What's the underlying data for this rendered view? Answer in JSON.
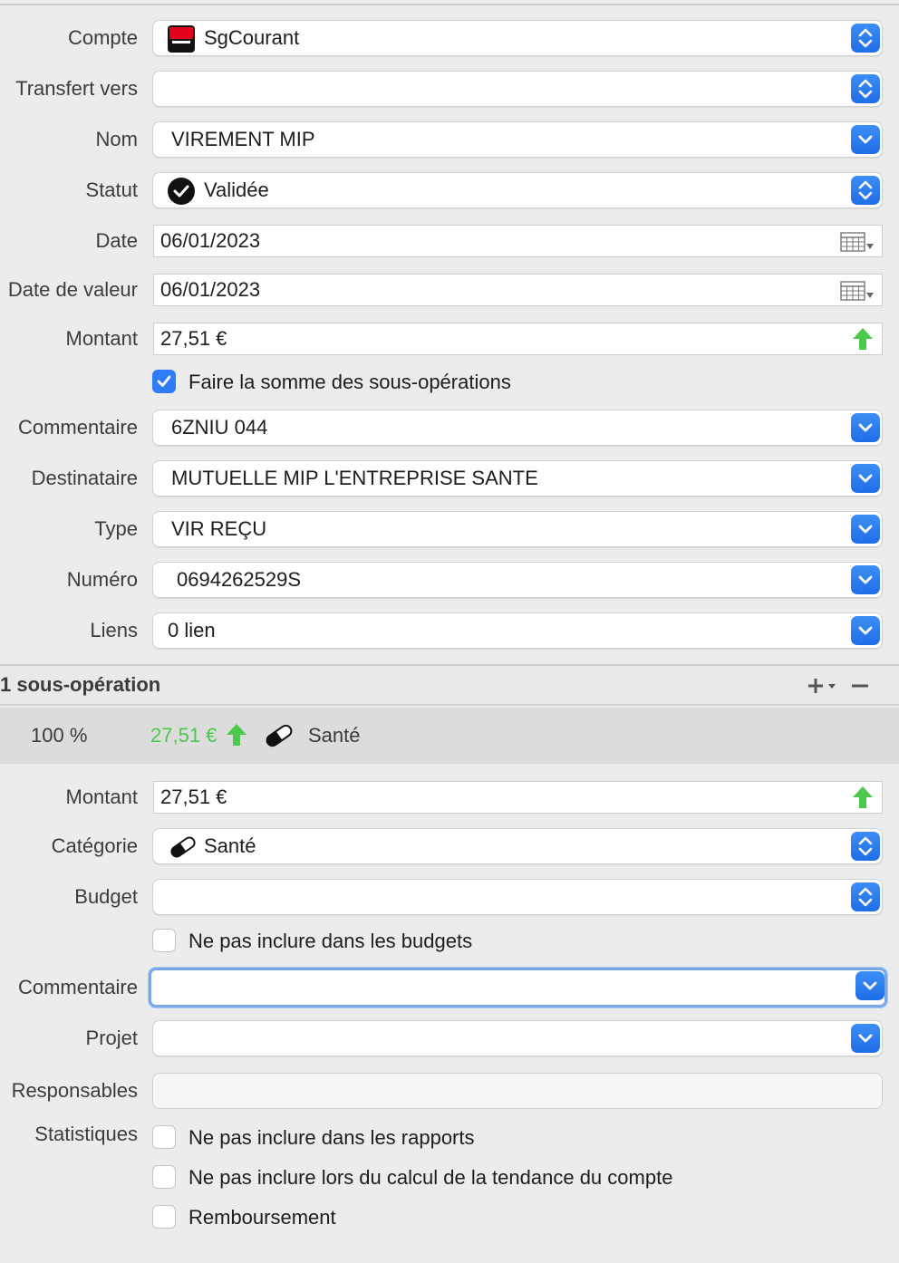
{
  "form": {
    "compte": {
      "label": "Compte",
      "value": "SgCourant",
      "icon": "bank-logo-icon"
    },
    "transfert": {
      "label": "Transfert vers",
      "value": ""
    },
    "nom": {
      "label": "Nom",
      "value": "VIREMENT MIP"
    },
    "statut": {
      "label": "Statut",
      "value": "Validée",
      "icon": "checkmark-circle-icon"
    },
    "date": {
      "label": "Date",
      "value": "06/01/2023"
    },
    "date_valeur": {
      "label": "Date de valeur",
      "value": "06/01/2023"
    },
    "montant": {
      "label": "Montant",
      "value": "27,51 €"
    },
    "somme_sous_ops": {
      "label": "Faire la somme des sous-opérations",
      "checked": true
    },
    "commentaire": {
      "label": "Commentaire",
      "value": "6ZNIU 044"
    },
    "destinataire": {
      "label": "Destinataire",
      "value": "MUTUELLE MIP L'ENTREPRISE SANTE"
    },
    "type": {
      "label": "Type",
      "value": "VIR REÇU"
    },
    "numero": {
      "label": "Numéro",
      "value": "0694262529S"
    },
    "liens": {
      "label": "Liens",
      "value": "0 lien"
    }
  },
  "suboperations": {
    "title": "1 sous-opération",
    "add_label": "+",
    "remove_label": "−",
    "items": [
      {
        "percent": "100 %",
        "amount": "27,51 €",
        "category": "Santé",
        "icon": "pill-icon"
      }
    ]
  },
  "subform": {
    "montant": {
      "label": "Montant",
      "value": "27,51 €"
    },
    "categorie": {
      "label": "Catégorie",
      "value": "Santé",
      "icon": "pill-icon"
    },
    "budget": {
      "label": "Budget",
      "value": ""
    },
    "exclude_budgets": {
      "label": "Ne pas inclure dans les budgets",
      "checked": false
    },
    "commentaire": {
      "label": "Commentaire",
      "value": ""
    },
    "projet": {
      "label": "Projet",
      "value": ""
    },
    "responsables": {
      "label": "Responsables",
      "value": ""
    },
    "statistiques": {
      "label": "Statistiques"
    },
    "exclude_reports": {
      "label": "Ne pas inclure dans les rapports",
      "checked": false
    },
    "exclude_trend": {
      "label": "Ne pas inclure lors du calcul de la tendance du compte",
      "checked": false
    },
    "remboursement": {
      "label": "Remboursement",
      "checked": false
    }
  },
  "colors": {
    "accent": "#2f7cf6",
    "positive": "#4cc94c",
    "bank_red": "#e2001a"
  }
}
